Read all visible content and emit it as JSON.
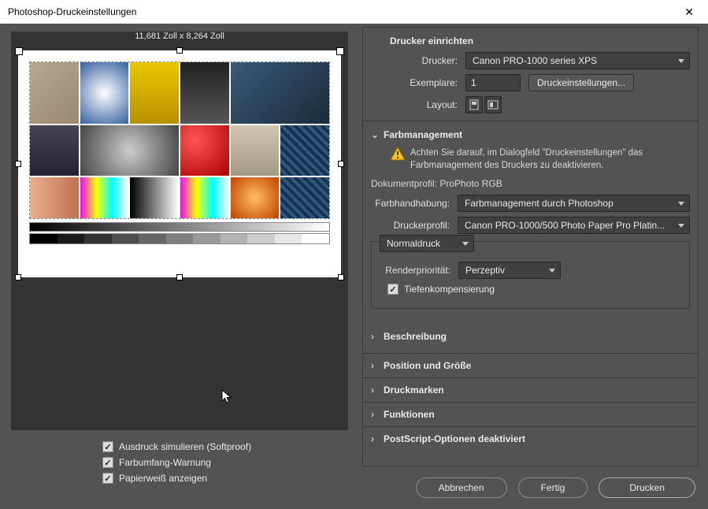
{
  "title": "Photoshop-Druckeinstellungen",
  "dimensions": "11,681 Zoll x 8,264 Zoll",
  "checkboxes": {
    "softproof": "Ausdruck simulieren (Softproof)",
    "gamut": "Farbumfang-Warnung",
    "paperwhite": "Papierweiß anzeigen"
  },
  "printer_setup": {
    "heading": "Drucker einrichten",
    "printer_label": "Drucker:",
    "printer_value": "Canon PRO-1000 series XPS",
    "copies_label": "Exemplare:",
    "copies_value": "1",
    "settings_btn": "Druckeinstellungen...",
    "layout_label": "Layout:"
  },
  "color_mgmt": {
    "heading": "Farbmanagement",
    "warning": "Achten Sie darauf, im Dialogfeld \"Druckeinstellungen\" das Farbmanagement des Druckers zu deaktivieren.",
    "doc_profile_label": "Dokumentprofil:",
    "doc_profile_value": "ProPhoto RGB",
    "handling_label": "Farbhandhabung:",
    "handling_value": "Farbmanagement durch Photoshop",
    "printer_profile_label": "Druckerprofil:",
    "printer_profile_value": "Canon PRO-1000/500 Photo Paper Pro Platin...",
    "mode_value": "Normaldruck",
    "render_label": "Renderpriorität:",
    "render_value": "Perzeptiv",
    "blackpoint": "Tiefenkompensierung",
    "desc_heading": "Beschreibung"
  },
  "collapsed": {
    "pos": "Position und Größe",
    "marks": "Druckmarken",
    "funcs": "Funktionen",
    "ps": "PostScript-Optionen deaktiviert"
  },
  "buttons": {
    "cancel": "Abbrechen",
    "done": "Fertig",
    "print": "Drucken"
  }
}
